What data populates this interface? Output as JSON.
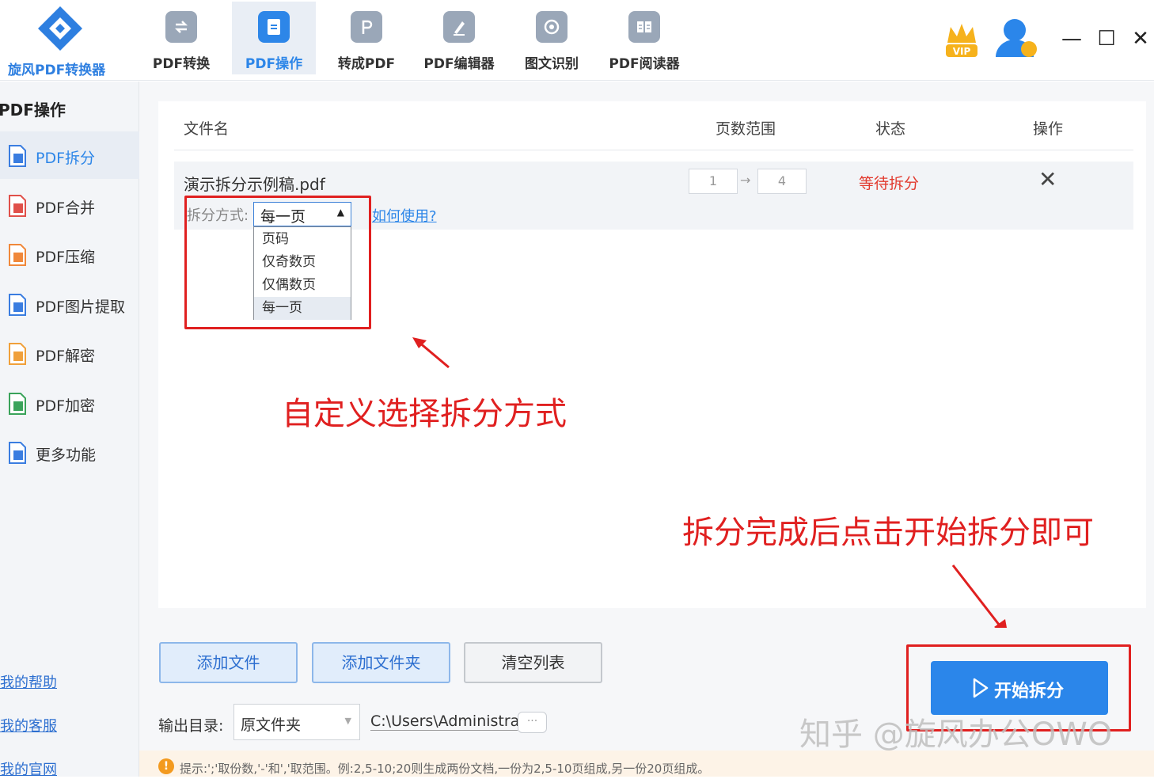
{
  "app": {
    "name": "旋风PDF转换器",
    "brand_color": "#2d86e8"
  },
  "nav": {
    "tabs": [
      {
        "label": "PDF转换",
        "icon": "convert-icon"
      },
      {
        "label": "PDF操作",
        "icon": "document-icon",
        "active": true
      },
      {
        "label": "转成PDF",
        "icon": "to-pdf-icon"
      },
      {
        "label": "PDF编辑器",
        "icon": "edit-icon"
      },
      {
        "label": "图文识别",
        "icon": "ocr-icon"
      },
      {
        "label": "PDF阅读器",
        "icon": "reader-icon"
      }
    ],
    "vip_label": "VIP"
  },
  "window": {
    "minimize": "—",
    "maximize": "☐",
    "close": "✕"
  },
  "sidebar": {
    "title": "PDF操作",
    "items": [
      {
        "label": "PDF拆分",
        "active": true,
        "color": "#3a7de0"
      },
      {
        "label": "PDF合并",
        "color": "#e0504a"
      },
      {
        "label": "PDF压缩",
        "color": "#f0883a"
      },
      {
        "label": "PDF图片提取",
        "color": "#3a7de0"
      },
      {
        "label": "PDF解密",
        "color": "#f0a03a"
      },
      {
        "label": "PDF加密",
        "color": "#3aa35a"
      },
      {
        "label": "更多功能",
        "color": "#3a7de0"
      }
    ],
    "links": [
      "我的帮助",
      "我的客服",
      "我的官网"
    ]
  },
  "table": {
    "headers": {
      "filename": "文件名",
      "page_range": "页数范围",
      "status": "状态",
      "action": "操作"
    },
    "row": {
      "filename": "演示拆分示例稿.pdf",
      "page_from": "1",
      "page_to": "4",
      "status": "等待拆分",
      "split_label": "拆分方式:",
      "split_value": "每一页",
      "howto": "如何使用?"
    },
    "dropdown_options": [
      "页码",
      "仅奇数页",
      "仅偶数页",
      "每一页"
    ],
    "dropdown_selected": "每一页"
  },
  "annotations": {
    "choose_method": "自定义选择拆分方式",
    "click_start": "拆分完成后点击开始拆分即可"
  },
  "bottom": {
    "add_file": "添加文件",
    "add_folder": "添加文件夹",
    "clear_list": "清空列表",
    "output_label": "输出目录:",
    "output_option": "原文件夹",
    "output_path": "C:\\Users\\Administrator",
    "browse": "···",
    "start": "开始拆分",
    "tip": "提示:';'取份数,'-'和','取范围。例:2,5-10;20则生成两份文档,一份为2,5-10页组成,另一份20页组成。"
  },
  "watermark": "知乎 @旋风办公OWO"
}
